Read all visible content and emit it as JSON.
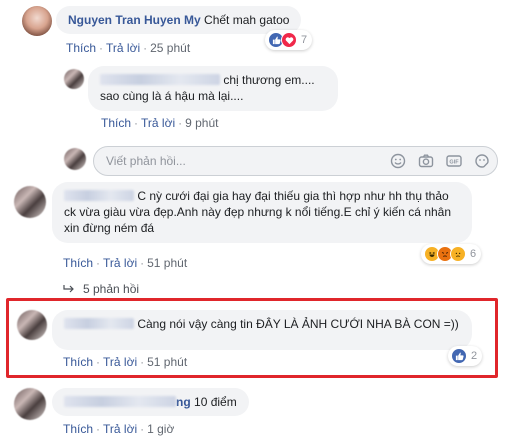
{
  "comments": [
    {
      "author": "Nguyen Tran Huyen My",
      "text": "Chết mah gatoo",
      "like": "Thích",
      "reply": "Trả lời",
      "time": "25 phút",
      "reaction_count": "7"
    },
    {
      "text": "chị thương em.... sao cùng là á hậu mà lại....",
      "like": "Thích",
      "reply": "Trả lời",
      "time": "9 phút"
    },
    {
      "text": "C nỳ cưới đại gia hay đại thiếu gia thì hợp như hh thụ thảo ck vừa giàu vừa đẹp.Anh này đẹp nhưng k nổi tiếng.E chỉ ý kiến cá nhân xin đừng ném đá",
      "like": "Thích",
      "reply": "Trả lời",
      "time": "51 phút",
      "reaction_count": "6"
    },
    {
      "text": "Càng nói vậy càng tin ĐÂY LÀ ẢNH CƯỚI NHA BÀ CON =))",
      "like": "Thích",
      "reply": "Trả lời",
      "time": "51 phút",
      "reaction_count": "2"
    },
    {
      "name_suffix": "ng",
      "text": "10 điểm",
      "like": "Thích",
      "reply": "Trả lời",
      "time": "1 giờ"
    }
  ],
  "reply_input": {
    "placeholder": "Viết phản hồi..."
  },
  "replies_link": "5 phản hồi",
  "colors": {
    "link": "#385898",
    "bubble": "#f2f3f5",
    "highlight": "#e0262b",
    "like": "#4267b2"
  }
}
